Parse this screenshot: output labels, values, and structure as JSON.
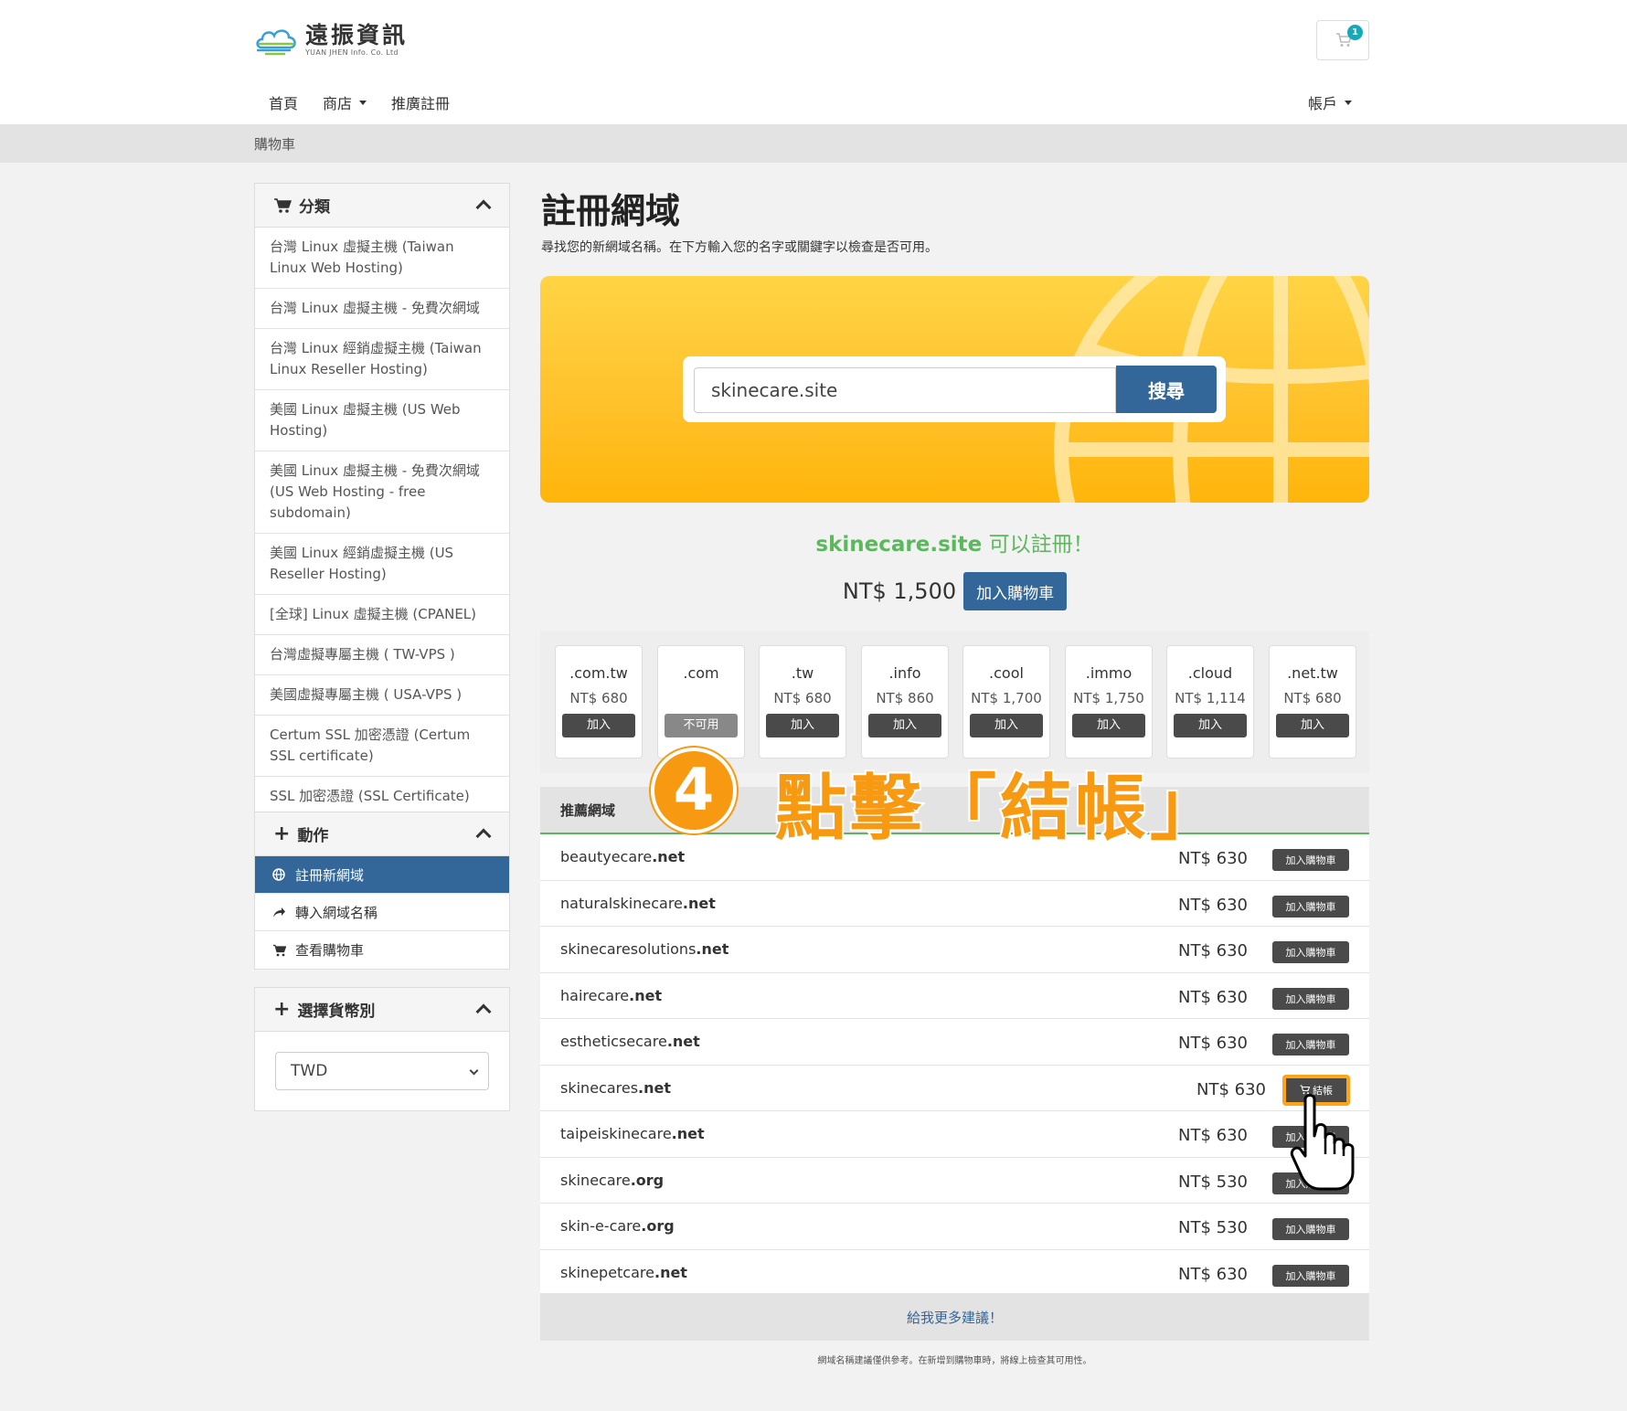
{
  "brand": {
    "name_cn": "遠振資訊",
    "name_en": "YUAN JHEN Info. Co. Ltd"
  },
  "cart": {
    "count": "1"
  },
  "nav": {
    "home": "首頁",
    "shop": "商店",
    "affiliate": "推廣註冊",
    "account": "帳戶"
  },
  "breadcrumb": "購物車",
  "categories": {
    "title": "分類",
    "items": [
      "台灣 Linux 虛擬主機 (Taiwan Linux Web Hosting)",
      "台灣 Linux 虛擬主機 - 免費次網域",
      "台灣 Linux 經銷虛擬主機 (Taiwan Linux Reseller Hosting)",
      "美國 Linux 虛擬主機 (US Web Hosting)",
      "美國 Linux 虛擬主機 - 免費次網域 (US Web Hosting - free subdomain)",
      "美國 Linux 經銷虛擬主機 (US Reseller Hosting)",
      "[全球] Linux 虛擬主機 (CPANEL)",
      "台灣虛擬專屬主機 ( TW-VPS )",
      "美國虛擬專屬主機 ( USA-VPS )",
      "Certum SSL 加密憑證 (Certum SSL certificate)",
      "SSL 加密憑證 (SSL Certificate)"
    ]
  },
  "actions": {
    "title": "動作",
    "items": [
      "註冊新網域",
      "轉入網域名稱",
      "查看購物車"
    ]
  },
  "currency": {
    "title": "選擇貨幣別",
    "selected": "TWD"
  },
  "main": {
    "title": "註冊網域",
    "subtitle": "尋找您的新網域名稱。在下方輸入您的名字或關鍵字以檢查是否可用。",
    "search_value": "skinecare.site",
    "search_button": "搜尋",
    "available_domain": "skinecare.site",
    "available_suffix": " 可以註冊！",
    "price": "NT$ 1,500",
    "add_to_cart": "加入購物車"
  },
  "tlds": [
    {
      "name": ".com.tw",
      "price": "NT$ 680",
      "button": "加入",
      "available": true
    },
    {
      "name": ".com",
      "price": "",
      "button": "不可用",
      "available": false
    },
    {
      "name": ".tw",
      "price": "NT$ 680",
      "button": "加入",
      "available": true
    },
    {
      "name": ".info",
      "price": "NT$ 860",
      "button": "加入",
      "available": true
    },
    {
      "name": ".cool",
      "price": "NT$ 1,700",
      "button": "加入",
      "available": true
    },
    {
      "name": ".immo",
      "price": "NT$ 1,750",
      "button": "加入",
      "available": true
    },
    {
      "name": ".cloud",
      "price": "NT$ 1,114",
      "button": "加入",
      "available": true
    },
    {
      "name": ".net.tw",
      "price": "NT$ 680",
      "button": "加入",
      "available": true
    }
  ],
  "suggestions": {
    "title": "推薦網域",
    "rows": [
      {
        "sld": "beautyecare",
        "tld": ".net",
        "price": "NT$ 630",
        "button": "加入購物車"
      },
      {
        "sld": "naturalskinecare",
        "tld": ".net",
        "price": "NT$ 630",
        "button": "加入購物車"
      },
      {
        "sld": "skinecaresolutions",
        "tld": ".net",
        "price": "NT$ 630",
        "button": "加入購物車"
      },
      {
        "sld": "hairecare",
        "tld": ".net",
        "price": "NT$ 630",
        "button": "加入購物車"
      },
      {
        "sld": "estheticsecare",
        "tld": ".net",
        "price": "NT$ 630",
        "button": "加入購物車"
      },
      {
        "sld": "skinecares",
        "tld": ".net",
        "price": "NT$ 630",
        "button": "結帳"
      },
      {
        "sld": "taipeiskinecare",
        "tld": ".net",
        "price": "NT$ 630",
        "button": "加入購物車"
      },
      {
        "sld": "skinecare",
        "tld": ".org",
        "price": "NT$ 530",
        "button": "加入購物車"
      },
      {
        "sld": "skin-e-care",
        "tld": ".org",
        "price": "NT$ 530",
        "button": "加入購物車"
      },
      {
        "sld": "skinepetcare",
        "tld": ".net",
        "price": "NT$ 630",
        "button": "加入購物車"
      }
    ],
    "more": "給我更多建議！",
    "footnote": "網域名稱建議僅供參考。在新增到購物車時，將線上檢查其可用性。"
  },
  "annotation": {
    "step": "4",
    "text": "點擊「結帳」"
  },
  "colors": {
    "primary": "#336699",
    "success": "#5cb85c",
    "accent": "#f79a11",
    "hero": "#ffc22c"
  }
}
